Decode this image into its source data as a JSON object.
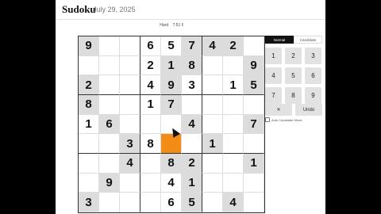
{
  "header": {
    "title": "Sudoku",
    "date": "July 29, 2025"
  },
  "game": {
    "difficulty": "Hard",
    "timer": "7:51 ‖"
  },
  "board": {
    "rows": [
      [
        {
          "v": "9",
          "g": true
        },
        {
          "v": "",
          "g": false
        },
        {
          "v": "",
          "g": false
        },
        {
          "v": "6",
          "g": false
        },
        {
          "v": "5",
          "g": false
        },
        {
          "v": "7",
          "g": true
        },
        {
          "v": "4",
          "g": true
        },
        {
          "v": "2",
          "g": true
        },
        {
          "v": "",
          "g": false
        }
      ],
      [
        {
          "v": "",
          "g": false
        },
        {
          "v": "",
          "g": false
        },
        {
          "v": "",
          "g": false
        },
        {
          "v": "2",
          "g": false
        },
        {
          "v": "1",
          "g": true
        },
        {
          "v": "8",
          "g": true
        },
        {
          "v": "",
          "g": false
        },
        {
          "v": "",
          "g": false
        },
        {
          "v": "9",
          "g": true
        }
      ],
      [
        {
          "v": "2",
          "g": true
        },
        {
          "v": "",
          "g": false
        },
        {
          "v": "",
          "g": false
        },
        {
          "v": "4",
          "g": false
        },
        {
          "v": "9",
          "g": true
        },
        {
          "v": "3",
          "g": false
        },
        {
          "v": "",
          "g": false
        },
        {
          "v": "1",
          "g": false
        },
        {
          "v": "5",
          "g": true
        }
      ],
      [
        {
          "v": "8",
          "g": true
        },
        {
          "v": "",
          "g": false
        },
        {
          "v": "",
          "g": false
        },
        {
          "v": "1",
          "g": false
        },
        {
          "v": "7",
          "g": true
        },
        {
          "v": "",
          "g": false
        },
        {
          "v": "",
          "g": false
        },
        {
          "v": "",
          "g": false
        },
        {
          "v": "",
          "g": false
        }
      ],
      [
        {
          "v": "1",
          "g": false
        },
        {
          "v": "6",
          "g": true
        },
        {
          "v": "",
          "g": false
        },
        {
          "v": "",
          "g": false
        },
        {
          "v": "",
          "g": false
        },
        {
          "v": "4",
          "g": true
        },
        {
          "v": "",
          "g": false
        },
        {
          "v": "",
          "g": false
        },
        {
          "v": "7",
          "g": true
        }
      ],
      [
        {
          "v": "",
          "g": false
        },
        {
          "v": "",
          "g": false
        },
        {
          "v": "3",
          "g": true
        },
        {
          "v": "8",
          "g": false
        },
        {
          "v": "",
          "g": false,
          "sel": true
        },
        {
          "v": "",
          "g": false
        },
        {
          "v": "1",
          "g": true
        },
        {
          "v": "",
          "g": false
        },
        {
          "v": "",
          "g": false
        }
      ],
      [
        {
          "v": "",
          "g": false
        },
        {
          "v": "",
          "g": false
        },
        {
          "v": "4",
          "g": true
        },
        {
          "v": "",
          "g": false
        },
        {
          "v": "8",
          "g": true
        },
        {
          "v": "2",
          "g": true
        },
        {
          "v": "",
          "g": false
        },
        {
          "v": "",
          "g": false
        },
        {
          "v": "1",
          "g": true
        }
      ],
      [
        {
          "v": "",
          "g": false
        },
        {
          "v": "9",
          "g": true
        },
        {
          "v": "",
          "g": false
        },
        {
          "v": "",
          "g": false
        },
        {
          "v": "4",
          "g": false
        },
        {
          "v": "1",
          "g": true
        },
        {
          "v": "",
          "g": false
        },
        {
          "v": "",
          "g": false
        },
        {
          "v": "",
          "g": false
        }
      ],
      [
        {
          "v": "3",
          "g": true
        },
        {
          "v": "",
          "g": false
        },
        {
          "v": "",
          "g": false
        },
        {
          "v": "",
          "g": false
        },
        {
          "v": "6",
          "g": false
        },
        {
          "v": "5",
          "g": true
        },
        {
          "v": "",
          "g": false
        },
        {
          "v": "4",
          "g": true
        },
        {
          "v": "",
          "g": false
        }
      ]
    ]
  },
  "modes": {
    "normal": "Normal",
    "candidate": "Candidate"
  },
  "keypad": [
    "1",
    "2",
    "3",
    "4",
    "5",
    "6",
    "7",
    "8",
    "9"
  ],
  "actions": {
    "erase": "✕",
    "undo": "Undo"
  },
  "options": {
    "auto_candidate": "Auto Candidate Mode"
  }
}
